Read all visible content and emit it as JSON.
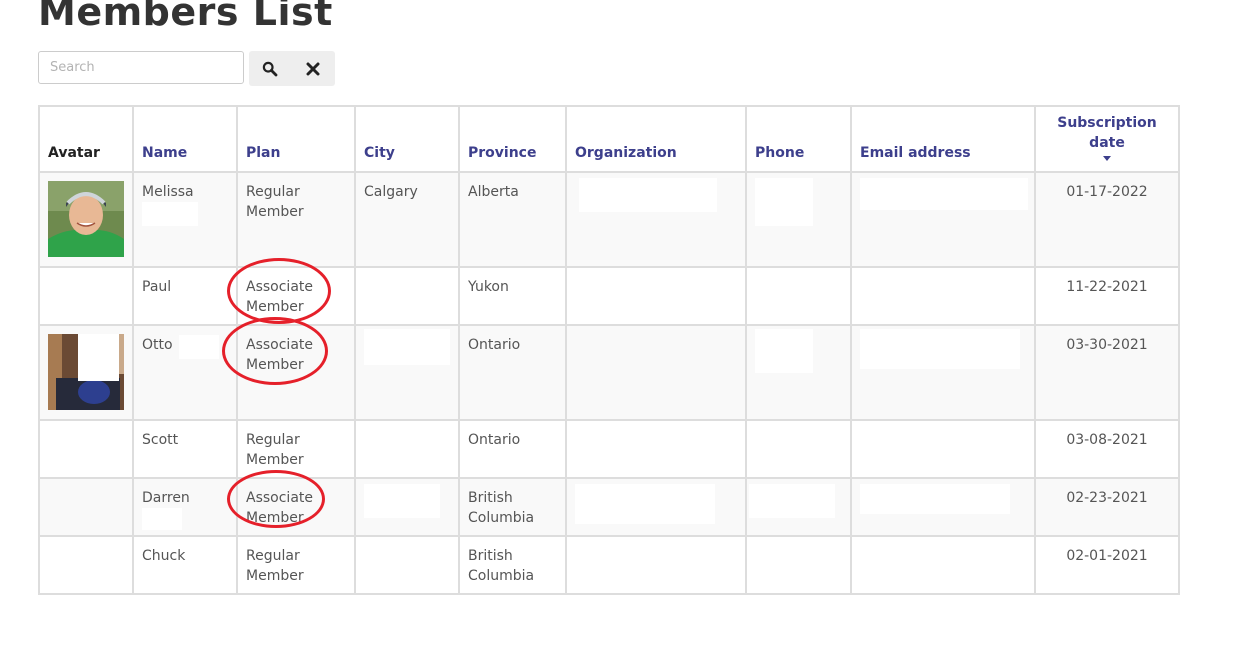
{
  "page": {
    "title": "Members List"
  },
  "search": {
    "placeholder": "Search"
  },
  "icons": {
    "search": "search-icon",
    "clear": "close-icon",
    "sort": "sort-desc-icon"
  },
  "colors": {
    "header_link": "#3d3f8c",
    "annotation_ring": "#e5202a",
    "row_stripe": "#f9f9f9"
  },
  "table": {
    "columns": [
      "Avatar",
      "Name",
      "Plan",
      "City",
      "Province",
      "Organization",
      "Phone",
      "Email address",
      "Subscription date"
    ],
    "sorted_column": "Subscription date",
    "sort_direction": "descending",
    "rows": [
      {
        "name": "Melissa",
        "plan": "Regular Member",
        "city": "Calgary",
        "province": "Alberta",
        "date": "01-17-2022"
      },
      {
        "name": "Paul",
        "plan": "Associate Member",
        "city": "",
        "province": "Yukon",
        "date": "11-22-2021"
      },
      {
        "name": "Otto",
        "plan": "Associate Member",
        "city": "",
        "province": "Ontario",
        "date": "03-30-2021"
      },
      {
        "name": "Scott",
        "plan": "Regular Member",
        "city": "",
        "province": "Ontario",
        "date": "03-08-2021"
      },
      {
        "name": "Darren",
        "plan": "Associate Member",
        "city": "",
        "province": "British Columbia",
        "date": "02-23-2021"
      },
      {
        "name": "Chuck",
        "plan": "Regular Member",
        "city": "",
        "province": "British Columbia",
        "date": "02-01-2021"
      }
    ]
  }
}
